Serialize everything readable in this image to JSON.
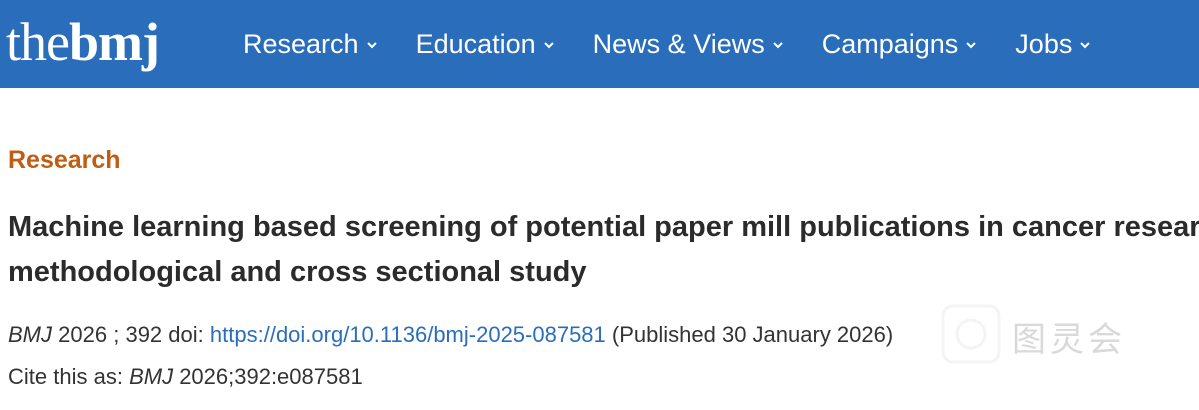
{
  "header": {
    "logo": {
      "part1": "the",
      "part2": "bmj"
    },
    "nav": [
      {
        "label": "Research"
      },
      {
        "label": "Education"
      },
      {
        "label": "News & Views"
      },
      {
        "label": "Campaigns"
      },
      {
        "label": "Jobs"
      }
    ],
    "colors": {
      "bar": "#2a6ebb",
      "section": "#c05d14"
    }
  },
  "article": {
    "section": "Research",
    "title": "Machine learning based screening of potential paper mill publications in cancer research: methodological and cross sectional study",
    "journal": "BMJ",
    "year": "2026",
    "separator": ";",
    "volume": "392",
    "doi_label": "doi:",
    "doi_url": "https://doi.org/10.1136/bmj-2025-087581",
    "published": "(Published 30 January 2026)",
    "cite_label": "Cite this as:",
    "cite_journal": "BMJ",
    "cite_ref": "2026;392:e087581"
  },
  "watermark": {
    "text": "图灵会"
  }
}
